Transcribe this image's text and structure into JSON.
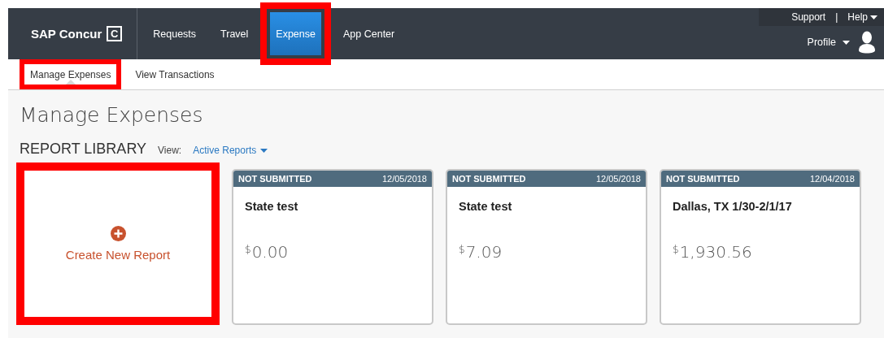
{
  "nav": {
    "logo": "SAP Concur",
    "logo_mark": "C",
    "tabs": [
      {
        "label": "Requests",
        "selected": false,
        "highlighted": false
      },
      {
        "label": "Travel",
        "selected": false,
        "highlighted": false
      },
      {
        "label": "Expense",
        "selected": true,
        "highlighted": true
      },
      {
        "label": "App Center",
        "selected": false,
        "highlighted": false
      }
    ],
    "utility_links": [
      "Support",
      "Help"
    ],
    "separator": "|",
    "profile": "Profile"
  },
  "subnav": [
    {
      "label": "Manage Expenses",
      "selected": true,
      "highlighted": true
    },
    {
      "label": "View Transactions",
      "selected": false,
      "highlighted": false
    }
  ],
  "page_title": "Manage Expenses",
  "library": {
    "title": "REPORT LIBRARY",
    "view_label": "View:",
    "view_value": "Active Reports"
  },
  "create_card": {
    "label": "Create New Report",
    "highlighted": true
  },
  "reports": [
    {
      "status": "NOT SUBMITTED",
      "date": "12/05/2018",
      "name": "State test",
      "currency": "$",
      "amount": "0.00"
    },
    {
      "status": "NOT SUBMITTED",
      "date": "12/05/2018",
      "name": "State test",
      "currency": "$",
      "amount": "7.09"
    },
    {
      "status": "NOT SUBMITTED",
      "date": "12/04/2018",
      "name": "Dallas, TX 1/30-2/1/17",
      "currency": "$",
      "amount": "1,930.56"
    }
  ]
}
